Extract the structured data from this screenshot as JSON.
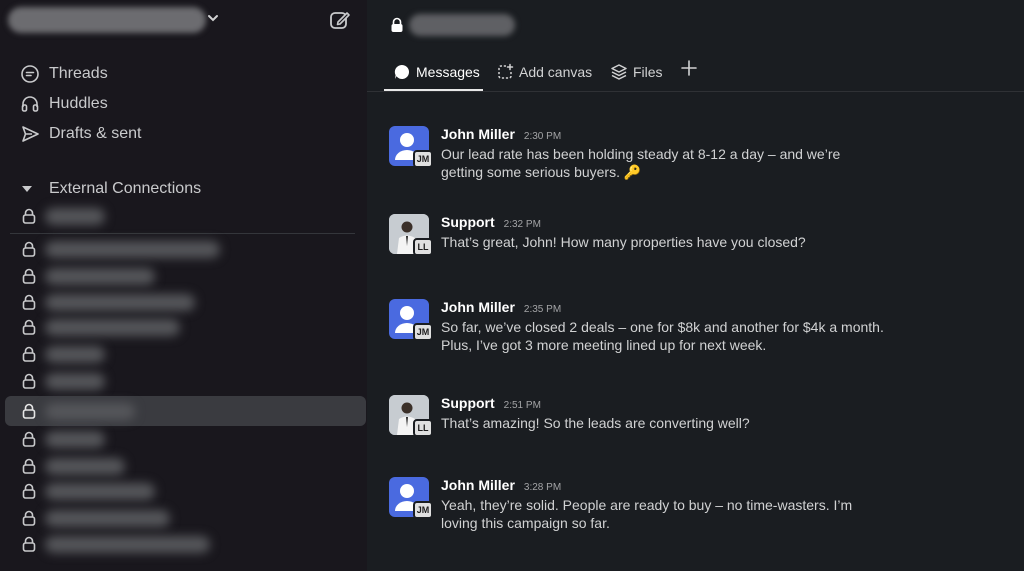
{
  "sidebar": {
    "nav": [
      {
        "label": "Threads",
        "icon": "threads-icon"
      },
      {
        "label": "Huddles",
        "icon": "headphones-icon"
      },
      {
        "label": "Drafts & sent",
        "icon": "send-icon"
      }
    ],
    "section": {
      "label": "External Connections"
    },
    "active_index": 7
  },
  "tabs": [
    {
      "label": "Messages",
      "icon": "message-bubble-icon",
      "active": true
    },
    {
      "label": "Add canvas",
      "icon": "canvas-icon"
    },
    {
      "label": "Files",
      "icon": "files-icon"
    }
  ],
  "messages": [
    {
      "author": "John Miller",
      "time": "2:30 PM",
      "initials": "JM",
      "text": "Our lead rate has been holding steady at 8-12 a day – and we’re getting some serious buyers. 🔑"
    },
    {
      "author": "Support",
      "time": "2:32 PM",
      "initials": "LL",
      "text": "That’s great, John! How many properties have you closed?"
    },
    {
      "author": "John Miller",
      "time": "2:35 PM",
      "initials": "JM",
      "text": "So far, we’ve closed 2 deals – one for $8k and another for $4k a month. Plus, I’ve got 3 more meeting lined up for next week."
    },
    {
      "author": "Support",
      "time": "2:51 PM",
      "initials": "LL",
      "text": "That’s amazing! So the leads are converting well?"
    },
    {
      "author": "John Miller",
      "time": "3:28 PM",
      "initials": "JM",
      "text": "Yeah, they’re solid. People are ready to buy – no time-wasters. I’m loving this campaign so far."
    }
  ],
  "colors": {
    "accent_avatar": "#4a6ae0",
    "active_row": "#3a3b40",
    "sidebar_bg": "#19171d",
    "main_bg": "#1a1d21"
  }
}
